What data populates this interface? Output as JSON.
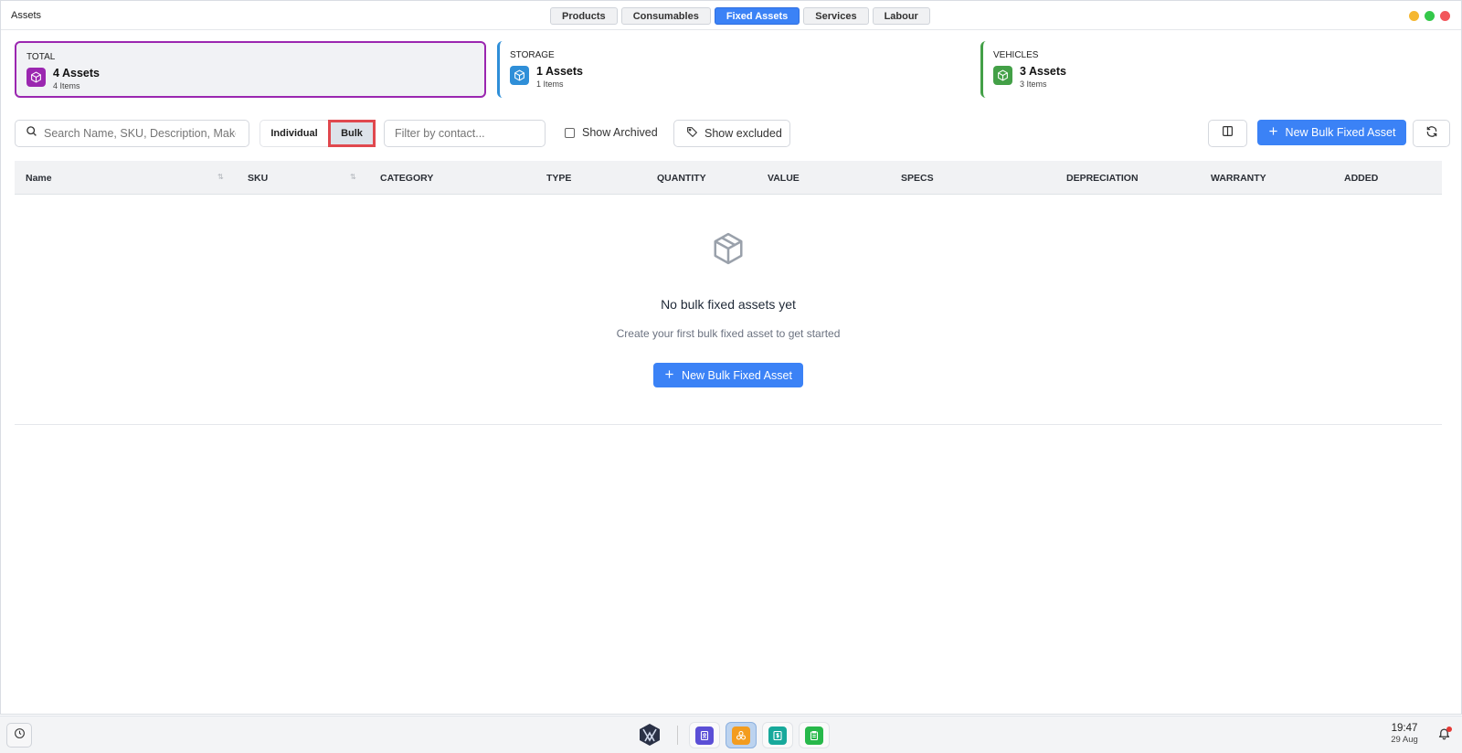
{
  "window": {
    "title": "Assets",
    "tabs": [
      {
        "label": "Products",
        "active": false
      },
      {
        "label": "Consumables",
        "active": false
      },
      {
        "label": "Fixed Assets",
        "active": true
      },
      {
        "label": "Services",
        "active": false
      },
      {
        "label": "Labour",
        "active": false
      }
    ],
    "controls_colors": {
      "minimize": "#f5b731",
      "maximize": "#34c84a",
      "close": "#f2575c"
    }
  },
  "summary": {
    "total": {
      "label": "TOTAL",
      "value": "4 Assets",
      "sub": "4 Items",
      "icon": "cube-icon",
      "color": "#9b27b0"
    },
    "storage": {
      "label": "STORAGE",
      "value": "1 Assets",
      "sub": "1 Items",
      "icon": "cube-icon",
      "color": "#2f8fd8"
    },
    "vehicles": {
      "label": "VEHICLES",
      "value": "3 Assets",
      "sub": "3 Items",
      "icon": "cube-icon",
      "color": "#43a047"
    }
  },
  "toolbar": {
    "search_placeholder": "Search Name, SKU, Description, Make, Model...",
    "view_individual": "Individual",
    "view_bulk": "Bulk",
    "view_selected": "Bulk",
    "filter_placeholder": "Filter by contact...",
    "show_archived": "Show Archived",
    "show_archived_checked": false,
    "show_excluded": "Show excluded",
    "new_button": "New Bulk Fixed Asset",
    "accent": "#3b82f6"
  },
  "table": {
    "columns": [
      "Name",
      "SKU",
      "CATEGORY",
      "TYPE",
      "QUANTITY",
      "VALUE",
      "SPECS",
      "DEPRECIATION",
      "WARRANTY",
      "ADDED"
    ]
  },
  "empty_state": {
    "title": "No bulk fixed assets yet",
    "subtitle": "Create your first bulk fixed asset to get started",
    "button": "New Bulk Fixed Asset"
  },
  "taskbar": {
    "apps": [
      {
        "name": "contacts-app",
        "color": "#5b4fd6",
        "active": false
      },
      {
        "name": "assets-app",
        "color": "#f39c1f",
        "active": true
      },
      {
        "name": "finance-app",
        "color": "#17a99b",
        "active": false
      },
      {
        "name": "clipboard-app",
        "color": "#27b84a",
        "active": false
      }
    ],
    "clock": {
      "time": "19:47",
      "date": "29 Aug"
    }
  }
}
